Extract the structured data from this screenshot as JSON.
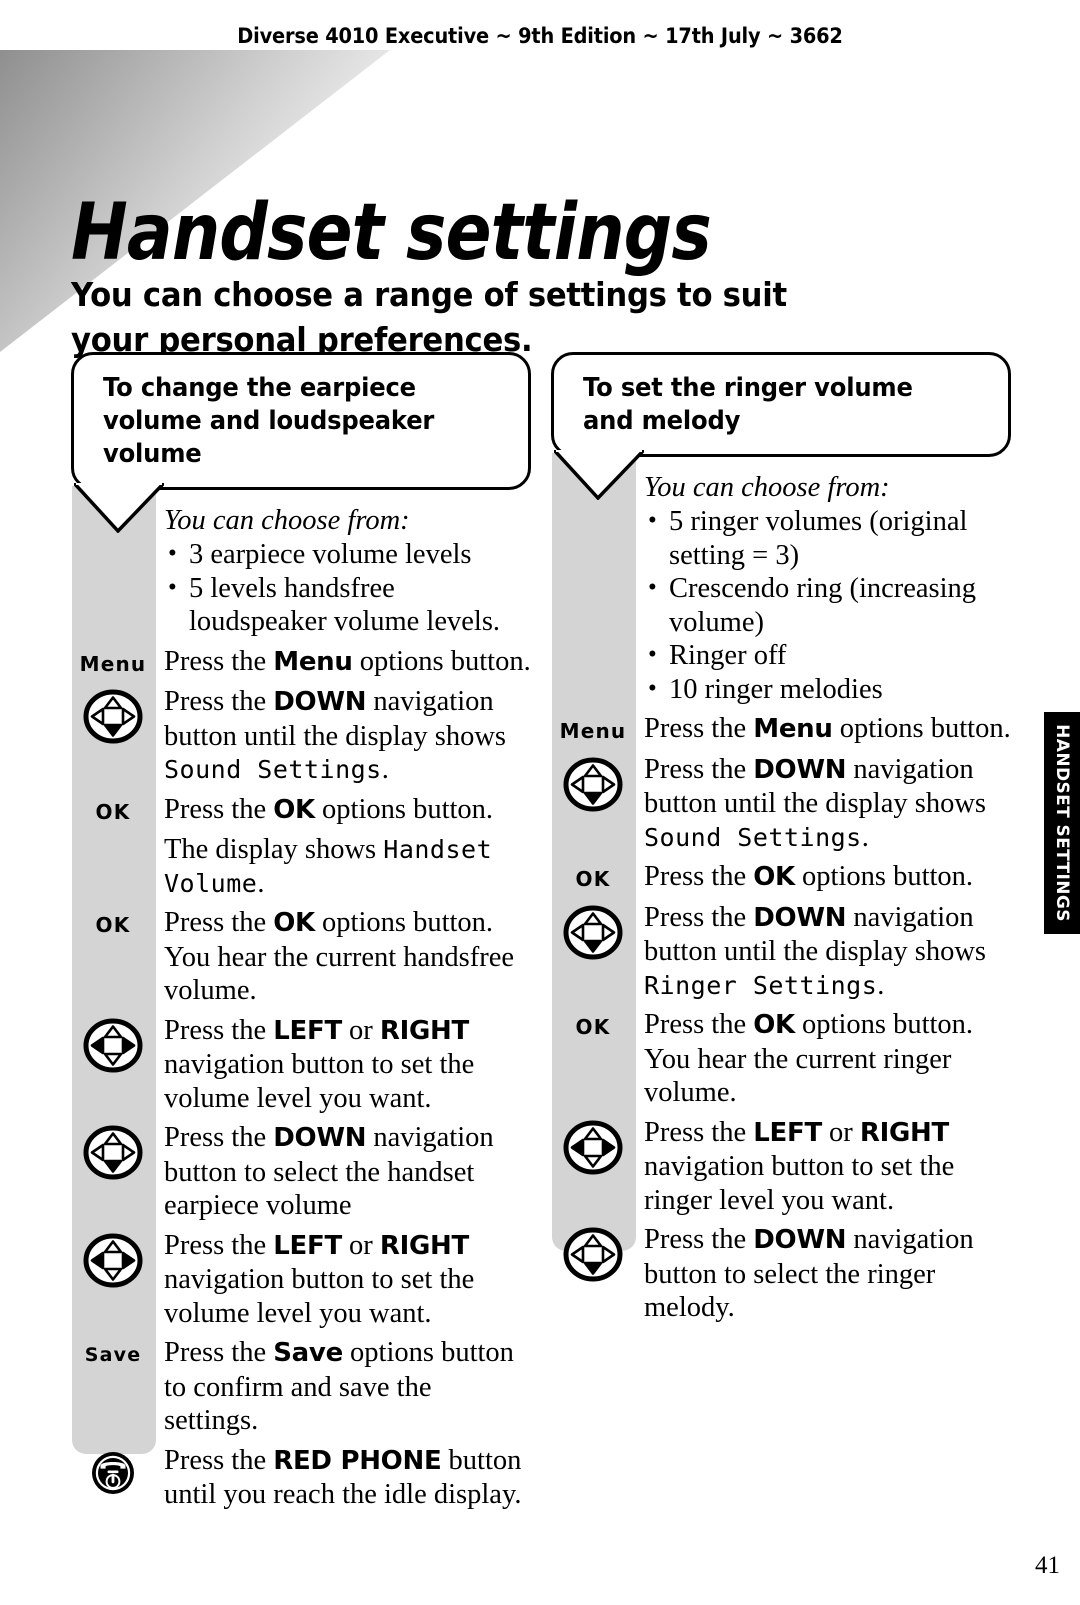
{
  "running_head": "Diverse 4010 Executive ~ 9th Edition ~ 17th July ~ 3662",
  "title": "Handset settings",
  "subtitle": "You can choose a range of settings to suit your personal preferences.",
  "thumb_tab": "HANDSET SETTINGS",
  "page_number": "41",
  "colors": {
    "rail_gray": "#d4d4d4",
    "tab_black": "#000000",
    "paper": "#ffffff"
  },
  "columns": [
    {
      "heading": "To change the earpiece volume and loudspeaker volume",
      "intro_lead": "You can choose from:",
      "intro_bullets": [
        "3 earpiece volume levels",
        "5 levels handsfree loudspeaker volume levels."
      ],
      "steps": [
        {
          "icon": "menu-key",
          "icon_label": "Menu",
          "parts": [
            {
              "t": "Press the ",
              "s": "plain"
            },
            {
              "t": "Menu",
              "s": "bold"
            },
            {
              "t": " options button.",
              "s": "plain"
            }
          ]
        },
        {
          "icon": "nav-down",
          "icon_label": "",
          "parts": [
            {
              "t": "Press the ",
              "s": "plain"
            },
            {
              "t": "DOWN",
              "s": "bold"
            },
            {
              "t": " navigation button until the display shows ",
              "s": "plain"
            },
            {
              "t": "Sound Settings",
              "s": "lcd"
            },
            {
              "t": ".",
              "s": "plain"
            }
          ]
        },
        {
          "icon": "ok-key",
          "icon_label": "OK",
          "parts": [
            {
              "t": "Press the ",
              "s": "plain"
            },
            {
              "t": "OK",
              "s": "bold"
            },
            {
              "t": " options button.",
              "s": "plain"
            }
          ]
        },
        {
          "icon": "none",
          "icon_label": "",
          "parts": [
            {
              "t": "The display shows ",
              "s": "plain"
            },
            {
              "t": "Handset Volume",
              "s": "lcd"
            },
            {
              "t": ".",
              "s": "plain"
            }
          ]
        },
        {
          "icon": "ok-key",
          "icon_label": "OK",
          "parts": [
            {
              "t": "Press the ",
              "s": "plain"
            },
            {
              "t": "OK",
              "s": "bold"
            },
            {
              "t": " options button. You hear the current handsfree volume.",
              "s": "plain"
            }
          ]
        },
        {
          "icon": "nav-leftright",
          "icon_label": "",
          "parts": [
            {
              "t": "Press the ",
              "s": "plain"
            },
            {
              "t": "LEFT",
              "s": "bold"
            },
            {
              "t": " or ",
              "s": "plain"
            },
            {
              "t": "RIGHT",
              "s": "bold"
            },
            {
              "t": " navigation button to set the volume level you want.",
              "s": "plain"
            }
          ]
        },
        {
          "icon": "nav-down",
          "icon_label": "",
          "parts": [
            {
              "t": "Press the ",
              "s": "plain"
            },
            {
              "t": "DOWN",
              "s": "bold"
            },
            {
              "t": " navigation button to select the handset earpiece volume",
              "s": "plain"
            }
          ]
        },
        {
          "icon": "nav-leftright",
          "icon_label": "",
          "parts": [
            {
              "t": "Press the ",
              "s": "plain"
            },
            {
              "t": "LEFT",
              "s": "bold"
            },
            {
              "t": " or ",
              "s": "plain"
            },
            {
              "t": "RIGHT",
              "s": "bold"
            },
            {
              "t": " navigation button to set the volume level you want.",
              "s": "plain"
            }
          ]
        },
        {
          "icon": "save-key",
          "icon_label": "Save",
          "parts": [
            {
              "t": "Press the ",
              "s": "plain"
            },
            {
              "t": "Save",
              "s": "bold"
            },
            {
              "t": " options button to confirm and save the settings.",
              "s": "plain"
            }
          ]
        },
        {
          "icon": "red-phone",
          "icon_label": "",
          "parts": [
            {
              "t": "Press the ",
              "s": "plain"
            },
            {
              "t": "RED PHONE",
              "s": "bold"
            },
            {
              "t": " button until you reach the idle display.",
              "s": "plain"
            }
          ]
        }
      ]
    },
    {
      "heading": "To set the ringer volume and melody",
      "intro_lead": "You can choose from:",
      "intro_bullets": [
        "5 ringer volumes (original setting = 3)",
        "Crescendo ring (increasing volume)",
        "Ringer off",
        "10 ringer melodies"
      ],
      "steps": [
        {
          "icon": "menu-key",
          "icon_label": "Menu",
          "parts": [
            {
              "t": "Press the ",
              "s": "plain"
            },
            {
              "t": "Menu",
              "s": "bold"
            },
            {
              "t": " options button.",
              "s": "plain"
            }
          ]
        },
        {
          "icon": "nav-down",
          "icon_label": "",
          "parts": [
            {
              "t": "Press the ",
              "s": "plain"
            },
            {
              "t": "DOWN",
              "s": "bold"
            },
            {
              "t": " navigation button until the display shows ",
              "s": "plain"
            },
            {
              "t": "Sound Settings",
              "s": "lcd"
            },
            {
              "t": ".",
              "s": "plain"
            }
          ]
        },
        {
          "icon": "ok-key",
          "icon_label": "OK",
          "parts": [
            {
              "t": "Press the ",
              "s": "plain"
            },
            {
              "t": "OK",
              "s": "bold"
            },
            {
              "t": " options button.",
              "s": "plain"
            }
          ]
        },
        {
          "icon": "nav-down",
          "icon_label": "",
          "parts": [
            {
              "t": "Press the ",
              "s": "plain"
            },
            {
              "t": "DOWN",
              "s": "bold"
            },
            {
              "t": " navigation button until the display shows ",
              "s": "plain"
            },
            {
              "t": "Ringer Settings",
              "s": "lcd"
            },
            {
              "t": ".",
              "s": "plain"
            }
          ]
        },
        {
          "icon": "ok-key",
          "icon_label": "OK",
          "parts": [
            {
              "t": "Press the ",
              "s": "plain"
            },
            {
              "t": "OK",
              "s": "bold"
            },
            {
              "t": " options button. You hear the current ringer volume.",
              "s": "plain"
            }
          ]
        },
        {
          "icon": "nav-leftright",
          "icon_label": "",
          "parts": [
            {
              "t": "Press the ",
              "s": "plain"
            },
            {
              "t": "LEFT",
              "s": "bold"
            },
            {
              "t": " or ",
              "s": "plain"
            },
            {
              "t": "RIGHT",
              "s": "bold"
            },
            {
              "t": " navigation button to set the ringer level you want.",
              "s": "plain"
            }
          ]
        },
        {
          "icon": "nav-down",
          "icon_label": "",
          "parts": [
            {
              "t": "Press the ",
              "s": "plain"
            },
            {
              "t": "DOWN",
              "s": "bold"
            },
            {
              "t": " navigation button to select the ringer melody.",
              "s": "plain"
            }
          ]
        }
      ]
    }
  ]
}
